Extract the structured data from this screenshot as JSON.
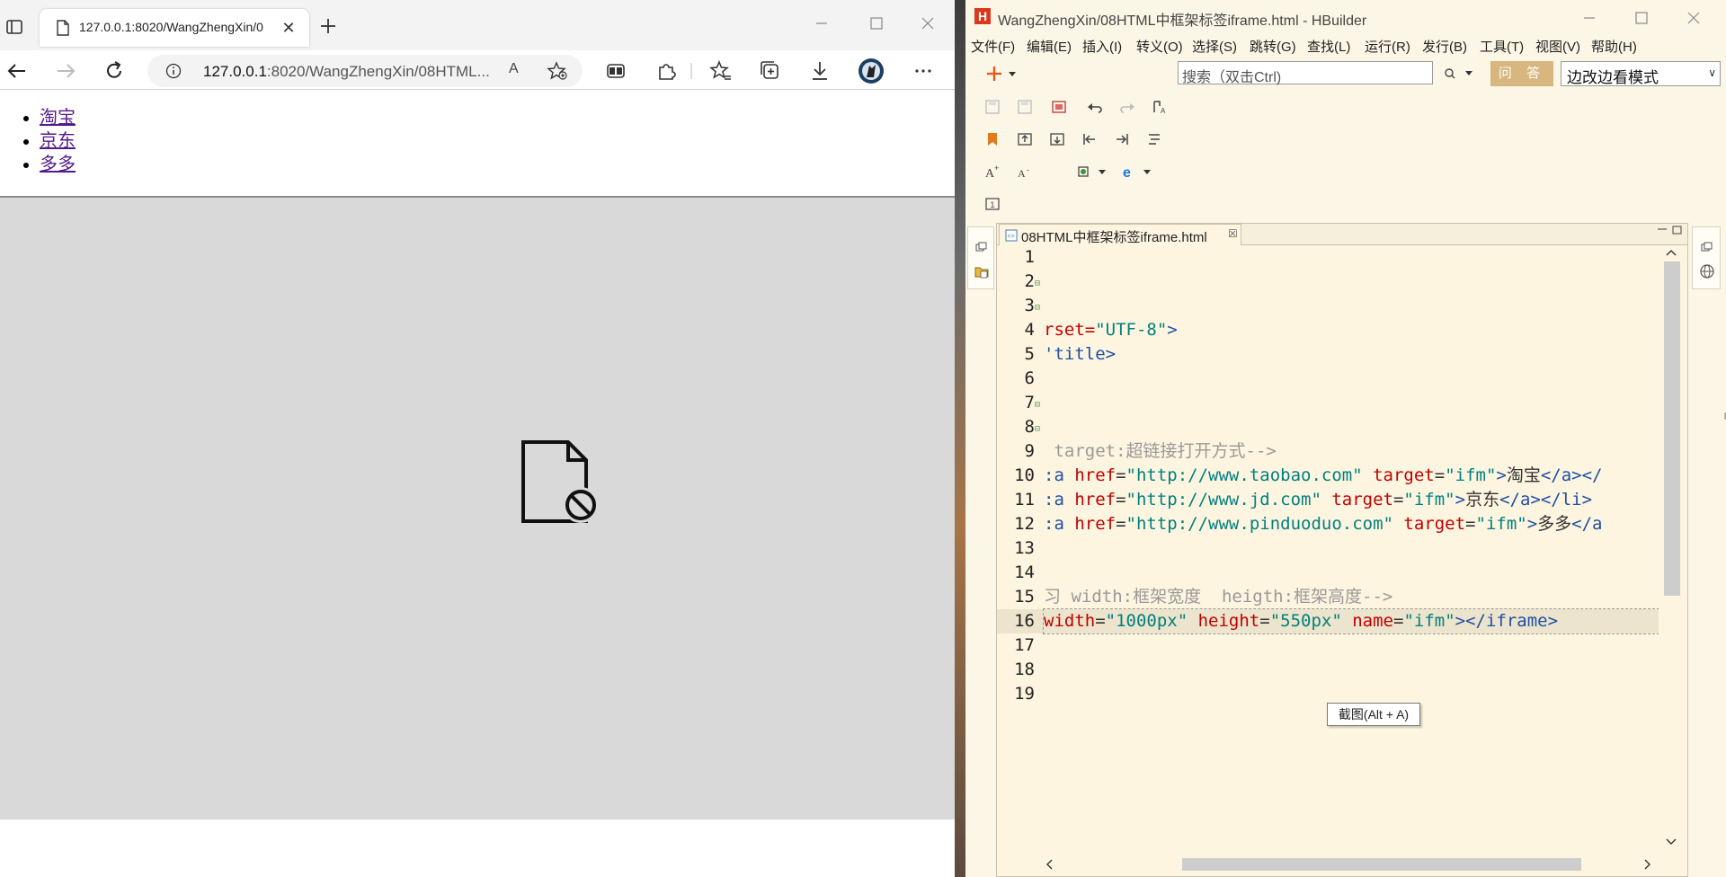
{
  "browser": {
    "tab": {
      "title": "127.0.0.1:8020/WangZhengXin/0",
      "close": "✕"
    },
    "address": {
      "host": "127.0.0.1",
      "path": ":8020/WangZhengXin/08HTML..."
    },
    "read_aloud": "A",
    "page": {
      "links": [
        {
          "label": "淘宝"
        },
        {
          "label": "京东"
        },
        {
          "label": "多多"
        }
      ],
      "iframe_state": "blocked-content-icon"
    }
  },
  "hbuilder": {
    "title": "WangZhengXin/08HTML中框架标签iframe.html  -  HBuilder",
    "menu": [
      "文件(F)",
      "编辑(E)",
      "插入(I)",
      "转义(O)",
      "选择(S)",
      "跳转(G)",
      "查找(L)",
      "运行(R)",
      "发行(B)",
      "工具(T)",
      "视图(V)",
      "帮助(H)"
    ],
    "search": {
      "placeholder": "搜索（双击Ctrl)"
    },
    "ask_button": "问 答",
    "mode_select": "边改边看模式",
    "editor_tab": {
      "label": "08HTML中框架标签iframe.html",
      "close": "☒"
    },
    "tooltip": "截图(Alt + A)",
    "code_lines": [
      {
        "n": "1",
        "fold": "",
        "segments": []
      },
      {
        "n": "2",
        "fold": "⊟",
        "segments": []
      },
      {
        "n": "3",
        "fold": "⊟",
        "segments": []
      },
      {
        "n": "4",
        "fold": "",
        "segments": [
          {
            "t": "rset=",
            "c": "c-attr"
          },
          {
            "t": "\"UTF-8\"",
            "c": "c-str"
          },
          {
            "t": ">",
            "c": "c-tag"
          }
        ]
      },
      {
        "n": "5",
        "fold": "",
        "segments": [
          {
            "t": "'title>",
            "c": "c-tag"
          }
        ]
      },
      {
        "n": "6",
        "fold": "",
        "segments": []
      },
      {
        "n": "7",
        "fold": "⊟",
        "segments": []
      },
      {
        "n": "8",
        "fold": "⊟",
        "segments": []
      },
      {
        "n": "9",
        "fold": "",
        "segments": [
          {
            "t": " target:超链接打开方式-->",
            "c": "c-cmt"
          }
        ]
      },
      {
        "n": "10",
        "fold": "",
        "segments": [
          {
            "t": ":a ",
            "c": "c-tag"
          },
          {
            "t": "href",
            "c": "c-attr"
          },
          {
            "t": "=",
            "c": "c-text"
          },
          {
            "t": "\"http://www.taobao.com\"",
            "c": "c-str"
          },
          {
            "t": " target",
            "c": "c-attr"
          },
          {
            "t": "=",
            "c": "c-text"
          },
          {
            "t": "\"ifm\"",
            "c": "c-str"
          },
          {
            "t": ">",
            "c": "c-tag"
          },
          {
            "t": "淘宝",
            "c": "c-text"
          },
          {
            "t": "</a></",
            "c": "c-tag"
          }
        ]
      },
      {
        "n": "11",
        "fold": "",
        "segments": [
          {
            "t": ":a ",
            "c": "c-tag"
          },
          {
            "t": "href",
            "c": "c-attr"
          },
          {
            "t": "=",
            "c": "c-text"
          },
          {
            "t": "\"http://www.jd.com\"",
            "c": "c-str"
          },
          {
            "t": " target",
            "c": "c-attr"
          },
          {
            "t": "=",
            "c": "c-text"
          },
          {
            "t": "\"ifm\"",
            "c": "c-str"
          },
          {
            "t": ">",
            "c": "c-tag"
          },
          {
            "t": "京东",
            "c": "c-text"
          },
          {
            "t": "</a></li>",
            "c": "c-tag"
          }
        ]
      },
      {
        "n": "12",
        "fold": "",
        "segments": [
          {
            "t": ":a ",
            "c": "c-tag"
          },
          {
            "t": "href",
            "c": "c-attr"
          },
          {
            "t": "=",
            "c": "c-text"
          },
          {
            "t": "\"http://www.pinduoduo.com\"",
            "c": "c-str"
          },
          {
            "t": " target",
            "c": "c-attr"
          },
          {
            "t": "=",
            "c": "c-text"
          },
          {
            "t": "\"ifm\"",
            "c": "c-str"
          },
          {
            "t": ">",
            "c": "c-tag"
          },
          {
            "t": "多多",
            "c": "c-text"
          },
          {
            "t": "</a",
            "c": "c-tag"
          }
        ]
      },
      {
        "n": "13",
        "fold": "",
        "segments": []
      },
      {
        "n": "14",
        "fold": "",
        "segments": []
      },
      {
        "n": "15",
        "fold": "",
        "segments": [
          {
            "t": "习 width:框架宽度  heigth:框架高度-->",
            "c": "c-cmt"
          }
        ]
      },
      {
        "n": "16",
        "fold": "",
        "current": true,
        "segments": [
          {
            "t": "width",
            "c": "c-attr"
          },
          {
            "t": "=",
            "c": "c-text"
          },
          {
            "t": "\"1000px\"",
            "c": "c-str"
          },
          {
            "t": " height",
            "c": "c-attr"
          },
          {
            "t": "=",
            "c": "c-text"
          },
          {
            "t": "\"550px\"",
            "c": "c-str"
          },
          {
            "t": " name",
            "c": "c-attr"
          },
          {
            "t": "=",
            "c": "c-text"
          },
          {
            "t": "\"ifm\"",
            "c": "c-str"
          },
          {
            "t": "></iframe>",
            "c": "c-tag"
          }
        ]
      },
      {
        "n": "17",
        "fold": "",
        "segments": []
      },
      {
        "n": "18",
        "fold": "",
        "segments": []
      },
      {
        "n": "19",
        "fold": "",
        "segments": []
      }
    ]
  }
}
